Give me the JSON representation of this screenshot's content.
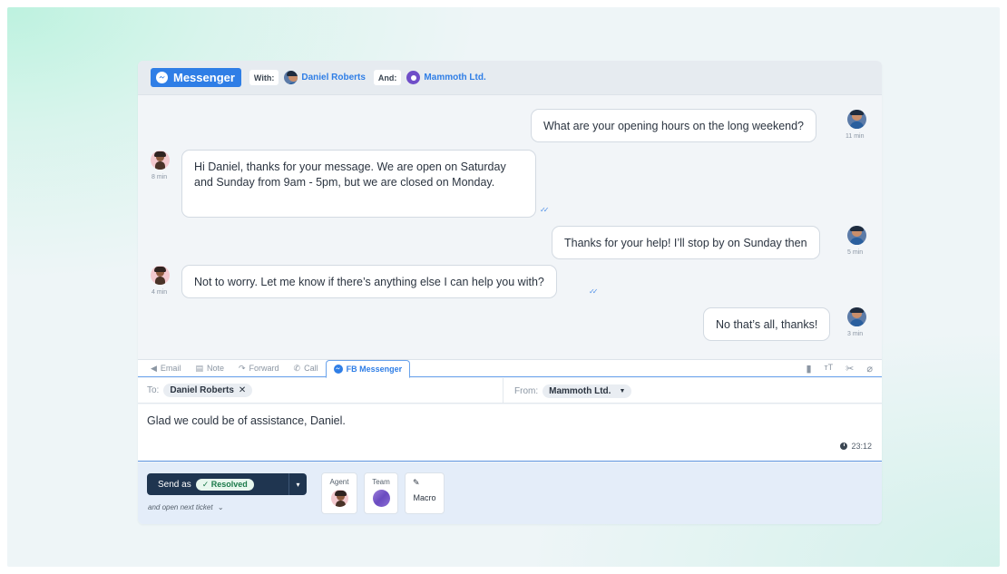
{
  "header": {
    "channel_label": "Messenger",
    "with_label": "With:",
    "customer_name": "Daniel Roberts",
    "and_label": "And:",
    "org_name": "Mammoth Ltd."
  },
  "messages": [
    {
      "side": "right",
      "text": "What are your opening hours on the long weekend?",
      "time": "11 min"
    },
    {
      "side": "left",
      "text": "Hi Daniel, thanks for your message. We are open on Saturday and Sunday from 9am - 5pm, but we are closed on Monday.",
      "time": "8 min"
    },
    {
      "side": "right",
      "text": "Thanks for your help! I’ll stop by on Sunday then",
      "time": "5 min"
    },
    {
      "side": "left",
      "text": "Not to worry. Let me know if there’s anything else I can help you with?",
      "time": "4 min"
    },
    {
      "side": "right",
      "text": "No that’s all, thanks!",
      "time": "3 min"
    }
  ],
  "composer": {
    "tabs": [
      "Email",
      "Note",
      "Forward",
      "Call",
      "FB Messenger"
    ],
    "active_tab": "FB Messenger",
    "to_label": "To:",
    "to_value": "Daniel Roberts",
    "from_label": "From:",
    "from_value": "Mammoth Ltd.",
    "reply_text": "Glad we could be of assistance, Daniel.",
    "timer": "23:12"
  },
  "actions": {
    "send_as_label": "Send as",
    "status": "Resolved",
    "next_ticket_label": "and open next ticket",
    "agent_label": "Agent",
    "team_label": "Team",
    "macro_label": "Macro"
  },
  "colors": {
    "accent": "#2f7ee6",
    "send_button": "#1f3550",
    "resolved_text": "#1b7a4a",
    "action_bar": "#e4edf9"
  }
}
